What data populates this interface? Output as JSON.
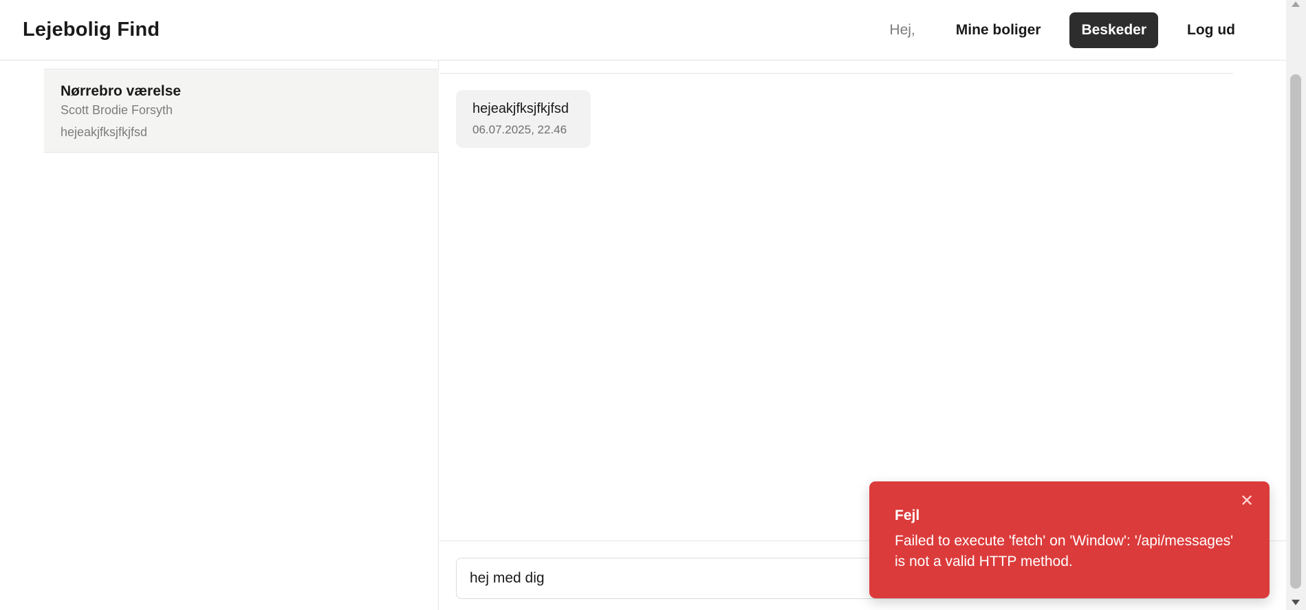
{
  "header": {
    "brand": "Lejebolig Find",
    "greeting": "Hej,",
    "nav": {
      "my_homes": "Mine boliger",
      "messages": "Beskeder",
      "logout": "Log ud"
    }
  },
  "sidebar": {
    "conversations": [
      {
        "title": "Nørrebro værelse",
        "name": "Scott Brodie Forsyth",
        "preview": "hejeakjfksjfkjfsd"
      }
    ]
  },
  "chat": {
    "messages": [
      {
        "text": "hejeakjfksjfkjfsd",
        "time": "06.07.2025, 22.46"
      }
    ],
    "composer_value": "hej med dig"
  },
  "toast": {
    "title": "Fejl",
    "message": "Failed to execute 'fetch' on 'Window': '/api/messages' is not a valid HTTP method.",
    "close_icon": "close-icon",
    "color": "#dc3b3b"
  }
}
